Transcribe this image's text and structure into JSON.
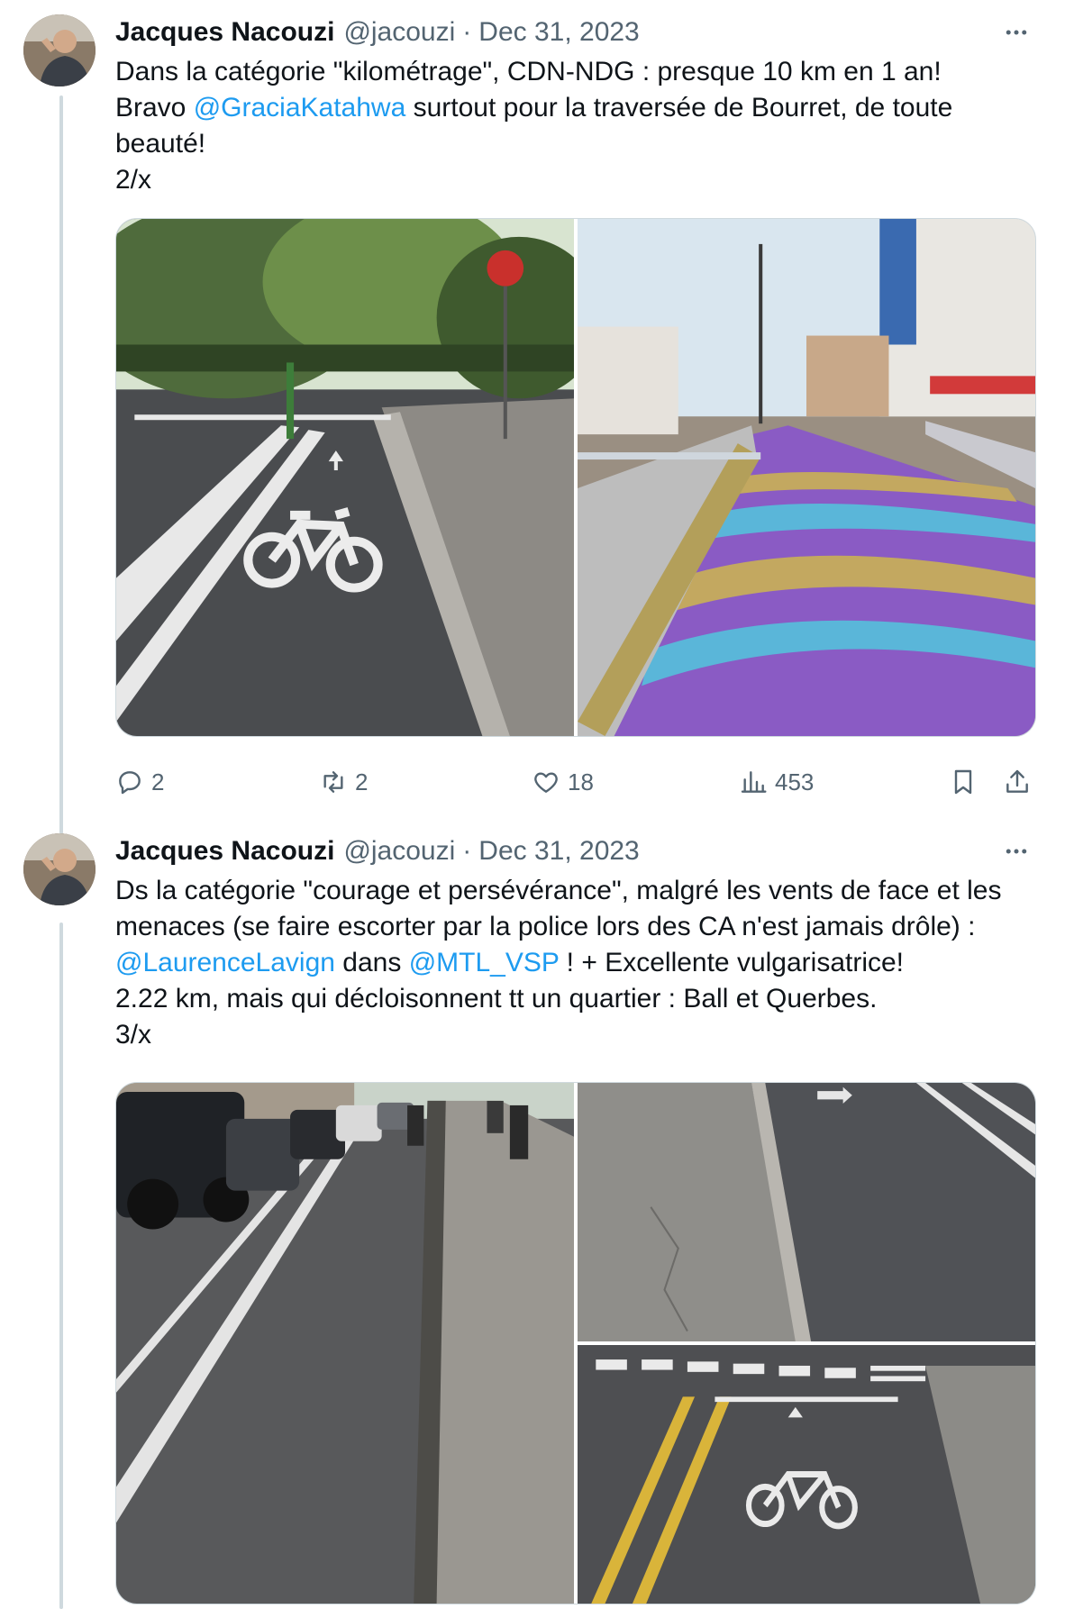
{
  "tweets": [
    {
      "author_name": "Jacques Nacouzi",
      "handle": "@jacouzi",
      "separator": "·",
      "date": "Dec 31, 2023",
      "lines": [
        [
          {
            "t": "Dans la catégorie \"kilométrage\", CDN-NDG : presque 10 km en 1 an!"
          }
        ],
        [
          {
            "t": "Bravo "
          },
          {
            "t": "@GraciaKatahwa",
            "m": true
          },
          {
            "t": " surtout pour la traversée de Bourret, de toute"
          }
        ],
        [
          {
            "t": "beauté!"
          }
        ],
        [
          {
            "t": "2/x"
          }
        ]
      ],
      "photos": [
        {
          "description_icon": "bike-lane-photo"
        },
        {
          "description_icon": "painted-bridge-photo"
        }
      ],
      "actions": {
        "reply_count": "2",
        "retweet_count": "2",
        "like_count": "18",
        "view_count": "453"
      }
    },
    {
      "author_name": "Jacques Nacouzi",
      "handle": "@jacouzi",
      "separator": "·",
      "date": "Dec 31, 2023",
      "lines": [
        [
          {
            "t": "Ds la catégorie \"courage et persévérance\", malgré les vents de face et les"
          }
        ],
        [
          {
            "t": "menaces (se faire escorter par la police lors des CA n'est jamais drôle) :"
          }
        ],
        [
          {
            "t": "@LaurenceLavign",
            "m": true
          },
          {
            "t": " dans "
          },
          {
            "t": "@MTL_VSP",
            "m": true
          },
          {
            "t": " ! + Excellente vulgarisatrice!"
          }
        ],
        [
          {
            "t": "2.22 km, mais qui décloisonnent tt un quartier : Ball et Querbes."
          }
        ],
        [
          {
            "t": "3/x"
          }
        ]
      ],
      "photos": [
        {
          "description_icon": "street-bike-lane-photo"
        },
        {
          "description_icon": "sidewalk-lane-photo"
        },
        {
          "description_icon": "crosswalk-bike-photo"
        }
      ]
    }
  ],
  "colors": {
    "text": "#0f1419",
    "secondary": "#536471",
    "mention": "#1d9bf0",
    "border": "#cfd9de"
  }
}
